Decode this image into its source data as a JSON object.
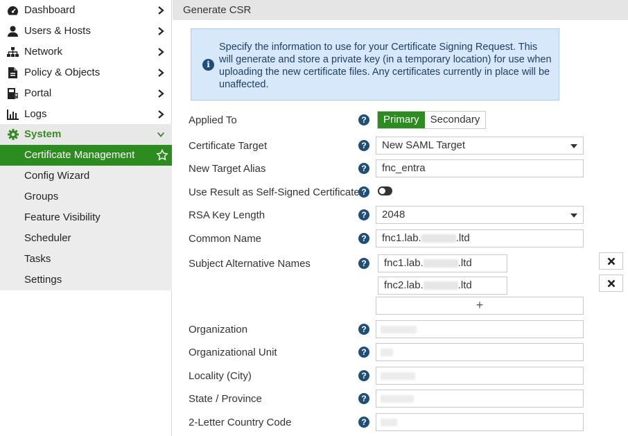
{
  "sidebar": {
    "items": [
      {
        "label": "Dashboard",
        "icon": "dashboard-icon"
      },
      {
        "label": "Users & Hosts",
        "icon": "user-icon"
      },
      {
        "label": "Network",
        "icon": "network-icon"
      },
      {
        "label": "Policy & Objects",
        "icon": "policy-icon"
      },
      {
        "label": "Portal",
        "icon": "portal-icon"
      },
      {
        "label": "Logs",
        "icon": "logs-icon"
      },
      {
        "label": "System",
        "icon": "gear-icon"
      }
    ],
    "subitems": [
      {
        "label": "Certificate Management"
      },
      {
        "label": "Config Wizard"
      },
      {
        "label": "Groups"
      },
      {
        "label": "Feature Visibility"
      },
      {
        "label": "Scheduler"
      },
      {
        "label": "Tasks"
      },
      {
        "label": "Settings"
      }
    ]
  },
  "header": {
    "title": "Generate CSR"
  },
  "info": {
    "text": "Specify the information to use for your Certificate Signing Request. This will generate and store a private key (in a temporary location) for use when uploading the new certificate files. Any certificates currently in place will be unaffected."
  },
  "form": {
    "applied_to": {
      "label": "Applied To",
      "options": [
        "Primary",
        "Secondary"
      ],
      "selected": "Primary"
    },
    "certificate_target": {
      "label": "Certificate Target",
      "value": "New SAML Target"
    },
    "new_target_alias": {
      "label": "New Target Alias",
      "value": "fnc_entra"
    },
    "self_signed": {
      "label": "Use Result as Self-Signed Certificate",
      "enabled": false
    },
    "rsa_key_length": {
      "label": "RSA Key Length",
      "value": "2048"
    },
    "common_name": {
      "label": "Common Name",
      "prefix": "fnc1.lab.",
      "suffix": ".ltd"
    },
    "san": {
      "label": "Subject Alternative Names",
      "entries": [
        {
          "prefix": "fnc1.lab.",
          "suffix": ".ltd"
        },
        {
          "prefix": "fnc2.lab.",
          "suffix": ".ltd"
        }
      ],
      "add_label": "+"
    },
    "organization": {
      "label": "Organization"
    },
    "organizational_unit": {
      "label": "Organizational Unit"
    },
    "locality": {
      "label": "Locality (City)"
    },
    "state": {
      "label": "State / Province"
    },
    "country": {
      "label": "2-Letter Country Code"
    }
  },
  "colors": {
    "accent": "#2d8c1f",
    "info_bg": "#d6e8fa",
    "help": "#1f4e79"
  }
}
